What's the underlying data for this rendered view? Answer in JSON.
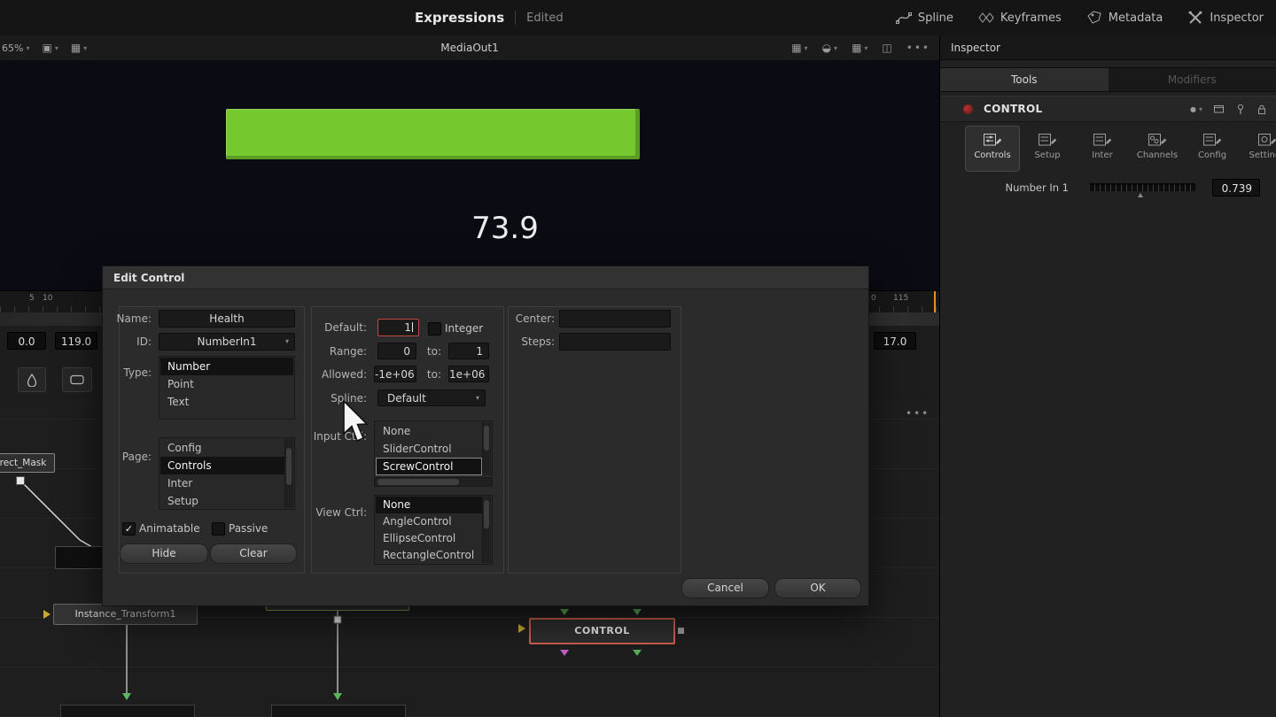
{
  "colors": {
    "health_bar": "#75c82d",
    "focus_outline": "#bf4a45",
    "selected_node_border": "#cd5f4f",
    "playhead_marker": "#df8f2d"
  },
  "topbar": {
    "title": "Expressions",
    "status": "Edited",
    "nav": [
      {
        "label": "Spline"
      },
      {
        "label": "Keyframes"
      },
      {
        "label": "Metadata"
      },
      {
        "label": "Inspector"
      }
    ]
  },
  "viewer_bar": {
    "zoom": "65%",
    "title": "MediaOut1",
    "ellipsis": "•••"
  },
  "viewer": {
    "readout": "73.9"
  },
  "timeline": {
    "tick_5": "5",
    "tick_10": "10",
    "tick_0": "0",
    "tick_115": "115",
    "in_value": "0.0",
    "out_value": "119.0",
    "right_value": "17.0",
    "ellipsis": "•••"
  },
  "node_editor": {
    "rect_mask_label": "rect_Mask",
    "instance_label": "Instance_Transform1",
    "control_label": "CONTROL"
  },
  "inspector": {
    "header": "Inspector",
    "tools_tab": "Tools",
    "modifiers_tab": "Modifiers",
    "node_title": "CONTROL",
    "section_tabs": [
      {
        "label": "Controls"
      },
      {
        "label": "Setup"
      },
      {
        "label": "Inter"
      },
      {
        "label": "Channels"
      },
      {
        "label": "Config"
      },
      {
        "label": "Settings"
      }
    ],
    "number_in_label": "Number In 1",
    "number_in_value": "0.739"
  },
  "dialog": {
    "title": "Edit Control",
    "name_label": "Name:",
    "name_value": "Health",
    "id_label": "ID:",
    "id_value": "NumberIn1",
    "type_label": "Type:",
    "type_items": [
      "Number",
      "Point",
      "Text"
    ],
    "page_label": "Page:",
    "page_items": [
      "Config",
      "Controls",
      "Inter",
      "Setup"
    ],
    "animatable_label": "Animatable",
    "passive_label": "Passive",
    "hide_button": "Hide",
    "clear_button": "Clear",
    "default_label": "Default:",
    "default_value": "1",
    "integer_label": "Integer",
    "range_label": "Range:",
    "range_from": "0",
    "to_label": "to:",
    "range_to": "1",
    "allowed_label": "Allowed:",
    "allowed_from": "-1e+06",
    "allowed_to": "1e+06",
    "spline_label": "Spline:",
    "spline_value": "Default",
    "input_ctrl_label": "Input Ctrl:",
    "input_ctrl_items": [
      "None",
      "SliderControl",
      "ScrewControl"
    ],
    "view_ctrl_label": "View Ctrl:",
    "view_ctrl_items": [
      "None",
      "AngleControl",
      "EllipseControl",
      "RectangleControl"
    ],
    "center_label": "Center:",
    "steps_label": "Steps:",
    "cancel_button": "Cancel",
    "ok_button": "OK"
  }
}
